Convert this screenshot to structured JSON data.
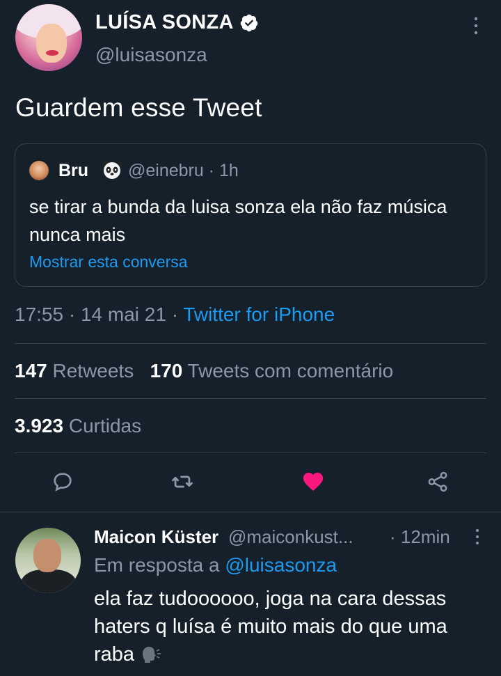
{
  "tweet": {
    "author_name": "LUÍSA SONZA",
    "author_handle": "@luisasonza",
    "text": "Guardem esse Tweet",
    "timestamp_time": "17:55 · 14 mai 21 · ",
    "timestamp_client": "Twitter for iPhone"
  },
  "quote": {
    "name": "Bru",
    "handle_time": "@einebru · 1h",
    "text": "se tirar a bunda da luisa sonza ela não faz música nunca mais",
    "show_thread": "Mostrar esta conversa"
  },
  "stats": {
    "retweets_count": "147",
    "retweets_label": " Retweets",
    "quotes_count": "170",
    "quotes_label": " Tweets com comentário",
    "likes_count": "3.923",
    "likes_label": " Curtidas"
  },
  "actions": {
    "icons": [
      "reply-icon",
      "retweet-icon",
      "like-icon",
      "share-icon"
    ],
    "like_color": "#f91880"
  },
  "reply": {
    "name": "Maicon Küster",
    "handle": "@maiconkust...",
    "time": "· 12min",
    "replying_prefix": "Em resposta a ",
    "replying_handle": "@luisasonza",
    "text": "ela faz tudoooooo, joga na cara dessas haters q luísa é muito mais do que uma raba"
  },
  "colors": {
    "background": "#15202b",
    "accent": "#1d9bf0",
    "muted": "#8b98a5",
    "border": "#38444d"
  }
}
